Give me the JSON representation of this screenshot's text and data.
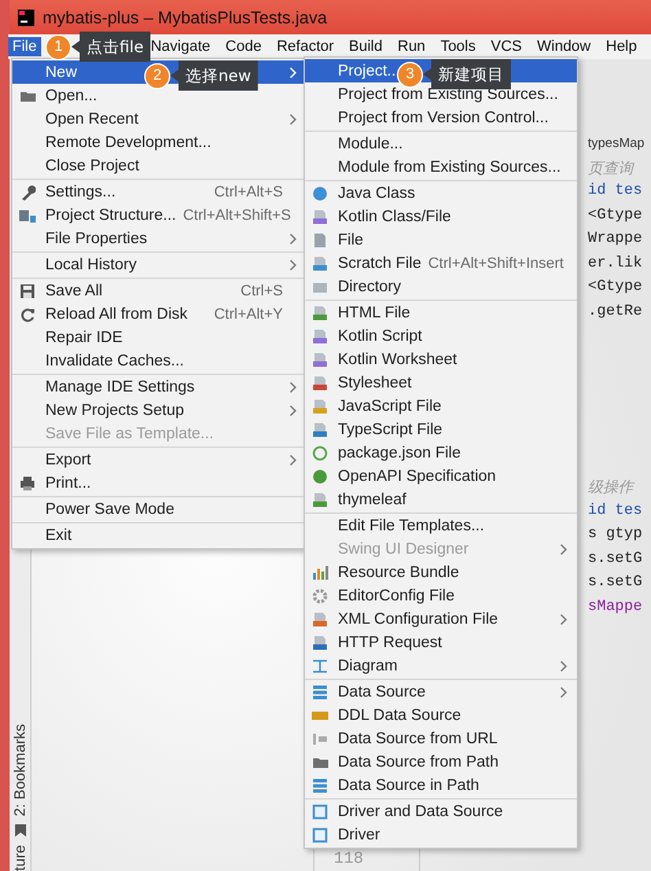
{
  "window": {
    "title": "mybatis-plus – MybatisPlusTests.java"
  },
  "menu_bar": [
    {
      "label": "File",
      "selected": true
    },
    {
      "label": "Navigate",
      "selected": false
    },
    {
      "label": "Code",
      "selected": false
    },
    {
      "label": "Refactor",
      "selected": false
    },
    {
      "label": "Build",
      "selected": false
    },
    {
      "label": "Run",
      "selected": false
    },
    {
      "label": "Tools",
      "selected": false
    },
    {
      "label": "VCS",
      "selected": false
    },
    {
      "label": "Window",
      "selected": false
    },
    {
      "label": "Help",
      "selected": false
    }
  ],
  "file_menu": {
    "groups": [
      [
        {
          "label": "New",
          "selected": true,
          "disabled": false,
          "submenu": true
        },
        {
          "label": "Open...",
          "selected": false,
          "disabled": false,
          "submenu": false
        },
        {
          "label": "Open Recent",
          "selected": false,
          "disabled": false,
          "submenu": true
        },
        {
          "label": "Remote Development...",
          "selected": false,
          "disabled": false,
          "submenu": false
        },
        {
          "label": "Close Project",
          "selected": false,
          "disabled": false,
          "submenu": false
        }
      ],
      [
        {
          "label": "Settings...",
          "shortcut": "Ctrl+Alt+S",
          "selected": false,
          "disabled": false,
          "submenu": false
        },
        {
          "label": "Project Structure...",
          "shortcut": "Ctrl+Alt+Shift+S",
          "selected": false,
          "disabled": false,
          "submenu": false
        },
        {
          "label": "File Properties",
          "selected": false,
          "disabled": false,
          "submenu": true
        }
      ],
      [
        {
          "label": "Local History",
          "selected": false,
          "disabled": false,
          "submenu": true
        }
      ],
      [
        {
          "label": "Save All",
          "shortcut": "Ctrl+S",
          "selected": false,
          "disabled": false,
          "submenu": false
        },
        {
          "label": "Reload All from Disk",
          "shortcut": "Ctrl+Alt+Y",
          "selected": false,
          "disabled": false,
          "submenu": false
        },
        {
          "label": "Repair IDE",
          "selected": false,
          "disabled": false,
          "submenu": false
        },
        {
          "label": "Invalidate Caches...",
          "selected": false,
          "disabled": false,
          "submenu": false
        }
      ],
      [
        {
          "label": "Manage IDE Settings",
          "selected": false,
          "disabled": false,
          "submenu": true
        },
        {
          "label": "New Projects Setup",
          "selected": false,
          "disabled": false,
          "submenu": true
        },
        {
          "label": "Save File as Template...",
          "selected": false,
          "disabled": true,
          "submenu": false
        }
      ],
      [
        {
          "label": "Export",
          "selected": false,
          "disabled": false,
          "submenu": true
        },
        {
          "label": "Print...",
          "selected": false,
          "disabled": false,
          "submenu": false
        }
      ],
      [
        {
          "label": "Power Save Mode",
          "selected": false,
          "disabled": false,
          "submenu": false
        }
      ],
      [
        {
          "label": "Exit",
          "selected": false,
          "disabled": false,
          "submenu": false
        }
      ]
    ]
  },
  "new_submenu": {
    "groups": [
      [
        {
          "label": "Project...",
          "selected": true,
          "disabled": false,
          "submenu": false
        },
        {
          "label": "Project from Existing Sources...",
          "selected": false,
          "disabled": false,
          "submenu": false
        },
        {
          "label": "Project from Version Control...",
          "selected": false,
          "disabled": false,
          "submenu": false
        }
      ],
      [
        {
          "label": "Module...",
          "selected": false,
          "disabled": false,
          "submenu": false
        },
        {
          "label": "Module from Existing Sources...",
          "selected": false,
          "disabled": false,
          "submenu": false
        }
      ],
      [
        {
          "label": "Java Class",
          "selected": false,
          "disabled": false,
          "submenu": false
        },
        {
          "label": "Kotlin Class/File",
          "selected": false,
          "disabled": false,
          "submenu": false
        },
        {
          "label": "File",
          "selected": false,
          "disabled": false,
          "submenu": false
        },
        {
          "label": "Scratch File",
          "shortcut": "Ctrl+Alt+Shift+Insert",
          "selected": false,
          "disabled": false,
          "submenu": false
        },
        {
          "label": "Directory",
          "selected": false,
          "disabled": false,
          "submenu": false
        }
      ],
      [
        {
          "label": "HTML File",
          "selected": false,
          "disabled": false,
          "submenu": false
        },
        {
          "label": "Kotlin Script",
          "selected": false,
          "disabled": false,
          "submenu": false
        },
        {
          "label": "Kotlin Worksheet",
          "selected": false,
          "disabled": false,
          "submenu": false
        },
        {
          "label": "Stylesheet",
          "selected": false,
          "disabled": false,
          "submenu": false
        },
        {
          "label": "JavaScript File",
          "selected": false,
          "disabled": false,
          "submenu": false
        },
        {
          "label": "TypeScript File",
          "selected": false,
          "disabled": false,
          "submenu": false
        },
        {
          "label": "package.json File",
          "selected": false,
          "disabled": false,
          "submenu": false
        },
        {
          "label": "OpenAPI Specification",
          "selected": false,
          "disabled": false,
          "submenu": false
        },
        {
          "label": "thymeleaf",
          "selected": false,
          "disabled": false,
          "submenu": false
        }
      ],
      [
        {
          "label": "Edit File Templates...",
          "selected": false,
          "disabled": false,
          "submenu": false
        },
        {
          "label": "Swing UI Designer",
          "selected": false,
          "disabled": true,
          "submenu": true
        },
        {
          "label": "Resource Bundle",
          "selected": false,
          "disabled": false,
          "submenu": false
        },
        {
          "label": "EditorConfig File",
          "selected": false,
          "disabled": false,
          "submenu": false
        },
        {
          "label": "XML Configuration File",
          "selected": false,
          "disabled": false,
          "submenu": true
        },
        {
          "label": "HTTP Request",
          "selected": false,
          "disabled": false,
          "submenu": false
        },
        {
          "label": "Diagram",
          "selected": false,
          "disabled": false,
          "submenu": true
        }
      ],
      [
        {
          "label": "Data Source",
          "selected": false,
          "disabled": false,
          "submenu": true
        },
        {
          "label": "DDL Data Source",
          "selected": false,
          "disabled": false,
          "submenu": false
        },
        {
          "label": "Data Source from URL",
          "selected": false,
          "disabled": false,
          "submenu": false
        },
        {
          "label": "Data Source from Path",
          "selected": false,
          "disabled": false,
          "submenu": false
        },
        {
          "label": "Data Source in Path",
          "selected": false,
          "disabled": false,
          "submenu": false
        }
      ],
      [
        {
          "label": "Driver and Data Source",
          "selected": false,
          "disabled": false,
          "submenu": false
        },
        {
          "label": "Driver",
          "selected": false,
          "disabled": false,
          "submenu": false
        }
      ]
    ]
  },
  "code_editor": {
    "blocks": [
      [
        {
          "text": "typesMap",
          "kind": "tab"
        },
        {
          "text": "页查询",
          "kind": "comment"
        },
        {
          "text": "id tes",
          "kind": "keyword"
        },
        {
          "text": "<Gtype",
          "kind": "code"
        },
        {
          "text": "Wrappe",
          "kind": "code"
        },
        {
          "text": "er.lik",
          "kind": "code"
        },
        {
          "text": "<Gtype",
          "kind": "code"
        },
        {
          "text": ".getRe",
          "kind": "code"
        }
      ],
      [
        {
          "text": "级操作",
          "kind": "comment"
        },
        {
          "text": "id tes",
          "kind": "keyword"
        },
        {
          "text": "s gtyp",
          "kind": "code"
        },
        {
          "text": "s.setG",
          "kind": "code"
        },
        {
          "text": "s.setG",
          "kind": "code"
        },
        {
          "text": "sMappe",
          "kind": "field"
        }
      ]
    ],
    "line_number": "118"
  },
  "tool_strip": [
    {
      "label": "2: Bookmarks"
    },
    {
      "label": "ture"
    }
  ],
  "callouts": [
    {
      "number": "1",
      "text": "点击file"
    },
    {
      "number": "2",
      "text": "选择new"
    },
    {
      "number": "3",
      "text": "新建项目"
    }
  ]
}
